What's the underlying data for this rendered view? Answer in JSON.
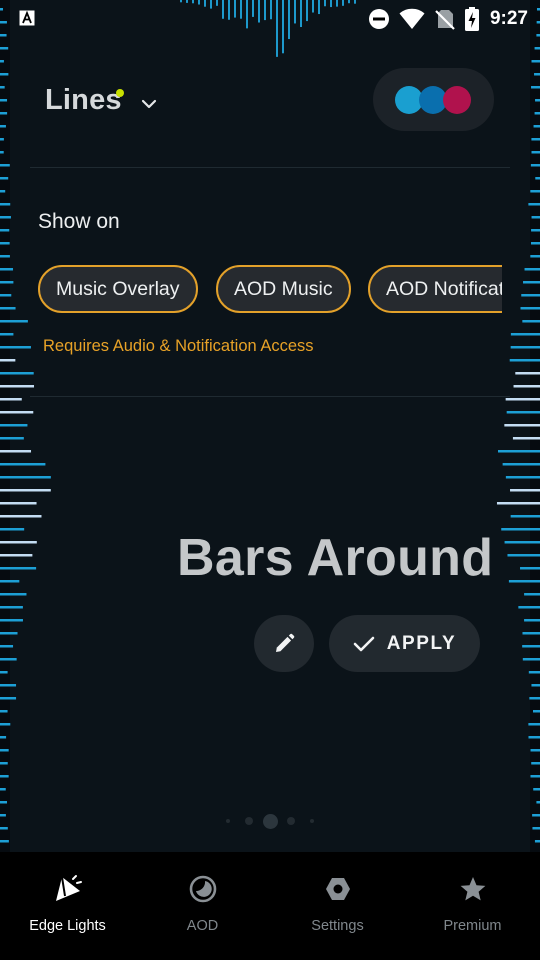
{
  "status_bar": {
    "time": "9:27",
    "icons": [
      "text-a-icon",
      "do-not-disturb-icon",
      "wifi-icon",
      "no-sim-icon",
      "battery-charging-icon"
    ]
  },
  "header": {
    "theme_name": "Lines",
    "palette_colors": [
      "#1a9fd0",
      "#0a6fae",
      "#b0124d"
    ]
  },
  "show_on": {
    "label": "Show on",
    "chips": [
      "Music Overlay",
      "AOD Music",
      "AOD Notifications"
    ],
    "note": "Requires Audio & Notification Access"
  },
  "preview": {
    "title": "Bars Around",
    "apply_label": "APPLY",
    "pager": {
      "count": 5,
      "active_index": 2
    }
  },
  "bottom_nav": {
    "items": [
      {
        "label": "Edge Lights",
        "icon": "edge-lights-icon",
        "active": true
      },
      {
        "label": "AOD",
        "icon": "moon-icon",
        "active": false
      },
      {
        "label": "Settings",
        "icon": "settings-hex-icon",
        "active": false
      },
      {
        "label": "Premium",
        "icon": "star-icon",
        "active": false
      }
    ]
  },
  "colors": {
    "accent": "#e3a12a",
    "edge_light": "#1fa8e0",
    "background": "#0b1319"
  }
}
